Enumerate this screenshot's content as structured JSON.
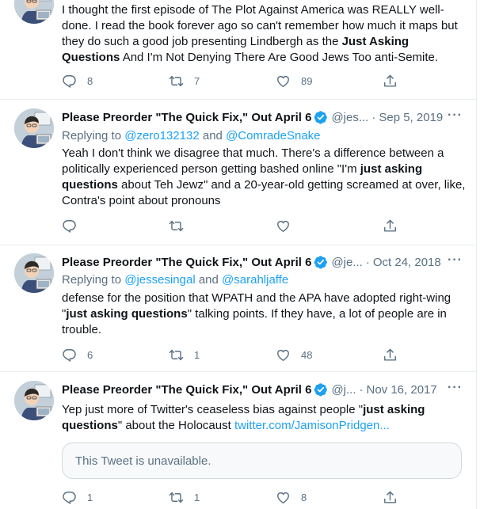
{
  "tweets": [
    {
      "text": {
        "p1": "I thought the first episode of The Plot Against America was REALLY well-done. I read the book forever ago so can't remember how much it maps but they do such a good job presenting Lindbergh as the ",
        "bold1": "Just Asking Questions",
        "p2": " And I'm Not Denying There Are Good Jews Too anti-Semite."
      },
      "replies": "8",
      "retweets": "7",
      "likes": "89"
    },
    {
      "name": "Please Preorder \"The Quick Fix,\" Out April 6",
      "handle": "@jes...",
      "dot": "·",
      "date": "Sep 5, 2019",
      "replying_prefix": "Replying to",
      "replying_to_1": "@zero132132",
      "replying_and": "and",
      "replying_to_2": "@ComradeSnake",
      "text": {
        "p1": "Yeah I don't think we disagree that much. There's a difference between a politically experienced person getting bashed online \"I'm ",
        "bold1": "just asking questions",
        "p2": " about Teh Jewz\" and a 20-year-old getting screamed at over, like, Contra's point about pronouns"
      },
      "replies": "",
      "retweets": "",
      "likes": ""
    },
    {
      "name": "Please Preorder \"The Quick Fix,\" Out April 6",
      "handle": "@je...",
      "dot": "·",
      "date": "Oct 24, 2018",
      "replying_prefix": "Replying to",
      "replying_to_1": "@jessesingal",
      "replying_and": "and",
      "replying_to_2": "@sarahljaffe",
      "text": {
        "p1": "defense for the position that WPATH and the APA have adopted right-wing \"",
        "bold1": "just asking questions",
        "p2": "\" talking points. If they have, a lot of people are in trouble."
      },
      "replies": "6",
      "retweets": "1",
      "likes": "48"
    },
    {
      "name": "Please Preorder \"The Quick Fix,\" Out April 6",
      "handle": "@j...",
      "dot": "·",
      "date": "Nov 16, 2017",
      "text": {
        "p1": "Yep just more of Twitter's ceaseless bias against people \"",
        "bold1": "just asking questions",
        "p2": "\" about the Holocaust ",
        "link": "twitter.com/JamisonPridgen..."
      },
      "embed": "This Tweet is unavailable.",
      "replies": "1",
      "retweets": "1",
      "likes": "8"
    }
  ],
  "colors": {
    "accent": "#1da1f2",
    "secondary_text": "#5b7083",
    "border": "#e6ecf0"
  },
  "icons": [
    "reply-icon",
    "retweet-icon",
    "like-icon",
    "share-icon",
    "verified-badge-icon",
    "more-icon"
  ]
}
